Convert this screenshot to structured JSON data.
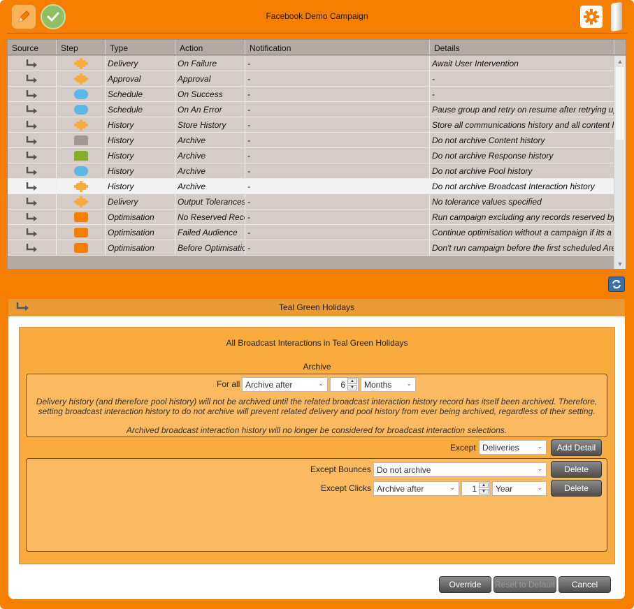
{
  "header": {
    "title": "Facebook Demo Campaign",
    "icons": [
      "pencil-icon",
      "check-icon",
      "gear-icon"
    ]
  },
  "grid": {
    "columns": [
      "Source",
      "Step",
      "Type",
      "Action",
      "Notification",
      "Details"
    ],
    "rows": [
      {
        "step_shape": "puzzle",
        "step_color": "#f8ab3e",
        "type": "Delivery",
        "action": "On Failure",
        "notification": "-",
        "details": "Await User Intervention"
      },
      {
        "step_shape": "puzzle",
        "step_color": "#f8ab3e",
        "type": "Approval",
        "action": "Approval",
        "notification": "-",
        "details": "-"
      },
      {
        "step_shape": "pill",
        "step_color": "#5cb8e4",
        "type": "Schedule",
        "action": "On Success",
        "notification": "-",
        "details": "-"
      },
      {
        "step_shape": "pill",
        "step_color": "#5cb8e4",
        "type": "Schedule",
        "action": "On An Error",
        "notification": "-",
        "details": "Pause group and retry on resume after retrying up"
      },
      {
        "step_shape": "puzzle",
        "step_color": "#f8ab3e",
        "type": "History",
        "action": "Store History",
        "notification": "-",
        "details": "Store all communications history and all content h"
      },
      {
        "step_shape": "tab",
        "step_color": "#a39791",
        "type": "History",
        "action": "Archive",
        "notification": "-",
        "details": "Do not archive Content history"
      },
      {
        "step_shape": "tab",
        "step_color": "#86ad2c",
        "type": "History",
        "action": "Archive",
        "notification": "-",
        "details": "Do not archive Response history"
      },
      {
        "step_shape": "pill",
        "step_color": "#5cb8e4",
        "type": "History",
        "action": "Archive",
        "notification": "-",
        "details": "Do not archive Pool history"
      },
      {
        "step_shape": "puzzle",
        "step_color": "#f8ab3e",
        "type": "History",
        "action": "Archive",
        "notification": "-",
        "details": "Do not archive Broadcast Interaction history",
        "selected": true
      },
      {
        "step_shape": "puzzle",
        "step_color": "#f8ab3e",
        "type": "Delivery",
        "action": "Output Tolerances",
        "notification": "-",
        "details": "No tolerance values specified"
      },
      {
        "step_shape": "rounded",
        "step_color": "#f77f00",
        "type": "Optimisation",
        "action": "No Reserved Records",
        "notification": "-",
        "details": "Run campaign excluding any records reserved by a"
      },
      {
        "step_shape": "rounded",
        "step_color": "#f77f00",
        "type": "Optimisation",
        "action": "Failed Audience",
        "notification": "-",
        "details": "Continue optimisation without a campaign if its a"
      },
      {
        "step_shape": "rounded",
        "step_color": "#f77f00",
        "type": "Optimisation",
        "action": "Before Optimisation",
        "notification": "-",
        "details": "Don't run campaign before the first scheduled Are"
      }
    ]
  },
  "panel": {
    "title": "Teal Green Holidays",
    "subtitle": "All Broadcast Interactions in Teal Green Holidays",
    "archive_label": "Archive",
    "for_all_label": "For all",
    "for_all_select": "Archive after",
    "for_all_number": "6",
    "for_all_unit": "Months",
    "info_line1": "Delivery history (and therefore pool history) will not be archived until the related broadcast interaction history record has itself been archived. Therefore,",
    "info_line2": "setting broadcast interaction history to do not archive will prevent related delivery and pool history from ever being archived, regardless of their setting.",
    "info_line3": "Archived broadcast interaction history will no longer be considered for broadcast interaction selections.",
    "except_label": "Except",
    "except_select": "Deliveries",
    "add_detail_label": "Add Detail",
    "except_rows": [
      {
        "label": "Except Bounces",
        "select": "Do not archive",
        "delete_label": "Delete"
      },
      {
        "label": "Except Clicks",
        "select": "Archive after",
        "number": "1",
        "unit": "Year",
        "delete_label": "Delete"
      }
    ]
  },
  "footer": {
    "override_label": "Override",
    "reset_label": "Reset to Default",
    "cancel_label": "Cancel"
  }
}
